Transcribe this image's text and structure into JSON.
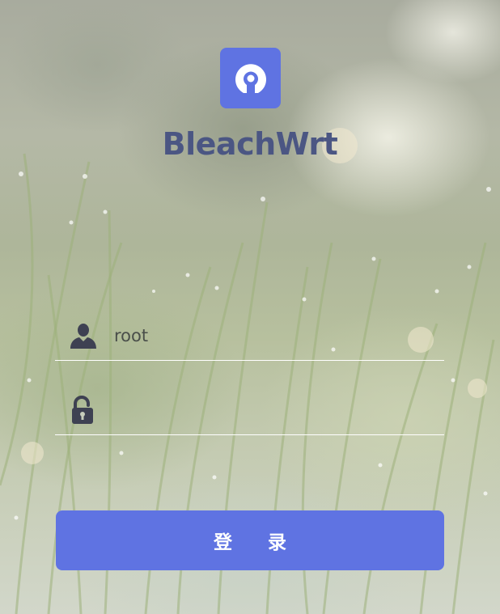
{
  "brand": {
    "name": "BleachWrt",
    "logo_icon": "bleachwrt-logo-icon",
    "accent_color": "#5f73e2",
    "text_color": "#4b5683"
  },
  "login_form": {
    "username": {
      "icon": "user-icon",
      "value": "root"
    },
    "password": {
      "icon": "unlock-icon",
      "value": ""
    },
    "submit_label": "登 录"
  }
}
